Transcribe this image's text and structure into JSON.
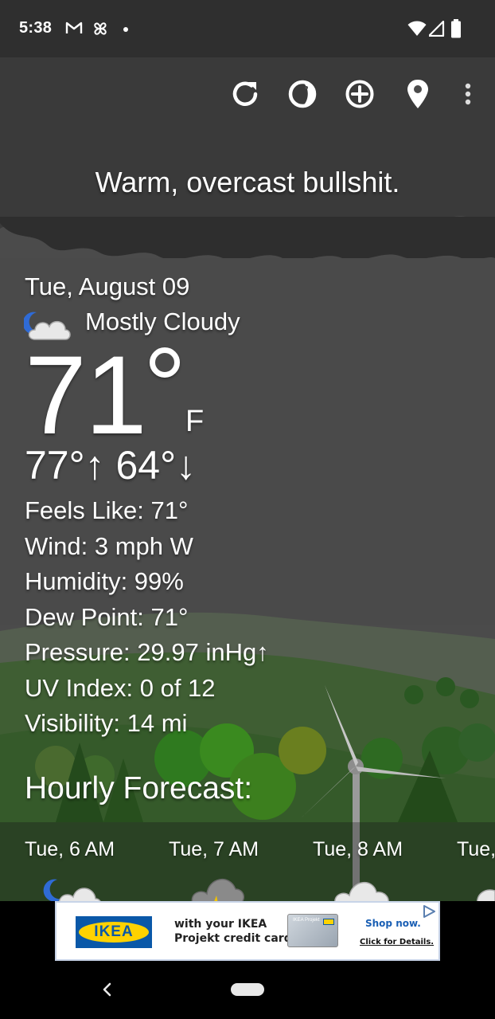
{
  "status_bar": {
    "time": "5:38",
    "left_icons": [
      "gmail-icon",
      "pinwheel-icon",
      "dot-icon"
    ],
    "right_icons": [
      "wifi-icon",
      "cell-signal-icon",
      "battery-icon"
    ]
  },
  "toolbar": {
    "buttons": [
      "refresh-icon",
      "theme-icon",
      "add-location-icon",
      "location-pin-icon",
      "more-vert-icon"
    ]
  },
  "headline": "Warm, overcast bullshit.",
  "current": {
    "date": "Tue, August 09",
    "condition": "Mostly Cloudy",
    "condition_icon": "partly-cloudy-night-icon",
    "temperature": "71",
    "unit": "F",
    "high_low": "77°↑ 64°↓",
    "feels_like": "Feels Like:  71°",
    "wind": "Wind:  3 mph W",
    "humidity": "Humidity:  99%",
    "dew_point": "Dew Point:  71°",
    "pressure": "Pressure:  29.97 inHg↑",
    "uv_index": "UV Index:  0 of 12",
    "visibility": "Visibility:  14 mi"
  },
  "hourly": {
    "title": "Hourly Forecast:",
    "items": [
      {
        "label": "Tue, 6 AM",
        "icon": "partly-cloudy-night-icon"
      },
      {
        "label": "Tue, 7 AM",
        "icon": "thunderstorm-icon"
      },
      {
        "label": "Tue, 8 AM",
        "icon": "cloud-icon"
      },
      {
        "label": "Tue,",
        "icon": "cloud-icon"
      }
    ]
  },
  "ad": {
    "brand": "IKEA",
    "text_line1": "with your IKEA",
    "text_line2": "Projekt credit card",
    "card_label": "IKEA Projekt",
    "cta": "Shop now.",
    "details": "Click for Details."
  },
  "colors": {
    "sky": "#4a4a4a",
    "status_bar": "#2f2f2f",
    "ikea_blue": "#0a58a8",
    "ikea_yellow": "#ffd200"
  }
}
